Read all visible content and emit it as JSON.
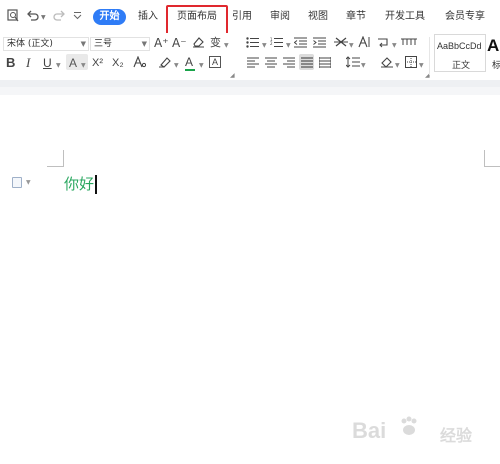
{
  "quick_access": {
    "icons": [
      "print-preview-icon",
      "undo-icon",
      "redo-icon",
      "customize-icon"
    ]
  },
  "tabs": [
    {
      "label": "开始",
      "active": true
    },
    {
      "label": "插入"
    },
    {
      "label": "页面布局",
      "highlighted": true
    },
    {
      "label": "引用"
    },
    {
      "label": "审阅"
    },
    {
      "label": "视图"
    },
    {
      "label": "章节"
    },
    {
      "label": "开发工具"
    },
    {
      "label": "会员专享"
    }
  ],
  "ribbon": {
    "font_name": "宋体 (正文)",
    "font_size": "三号",
    "grow_font": "A⁺",
    "shrink_font": "A⁻",
    "pinyin": "变",
    "bold": "B",
    "italic": "I",
    "underline": "U",
    "font_effect": "A",
    "superscript": "X²",
    "subscript": "X₂",
    "font_color": "A",
    "char_border": "A",
    "style_sample": "AaBbCcDd",
    "style_name": "正文",
    "style_big": "A",
    "style_side": "标"
  },
  "colors": {
    "accent": "#2f7cf6",
    "highlight_box": "#e0282e",
    "doc_text": "#2aa760",
    "font_color_bar": "#1aa34a"
  },
  "document": {
    "text": "你好"
  },
  "watermark": {
    "brand": "Bai",
    "brand_tail": "经验"
  }
}
